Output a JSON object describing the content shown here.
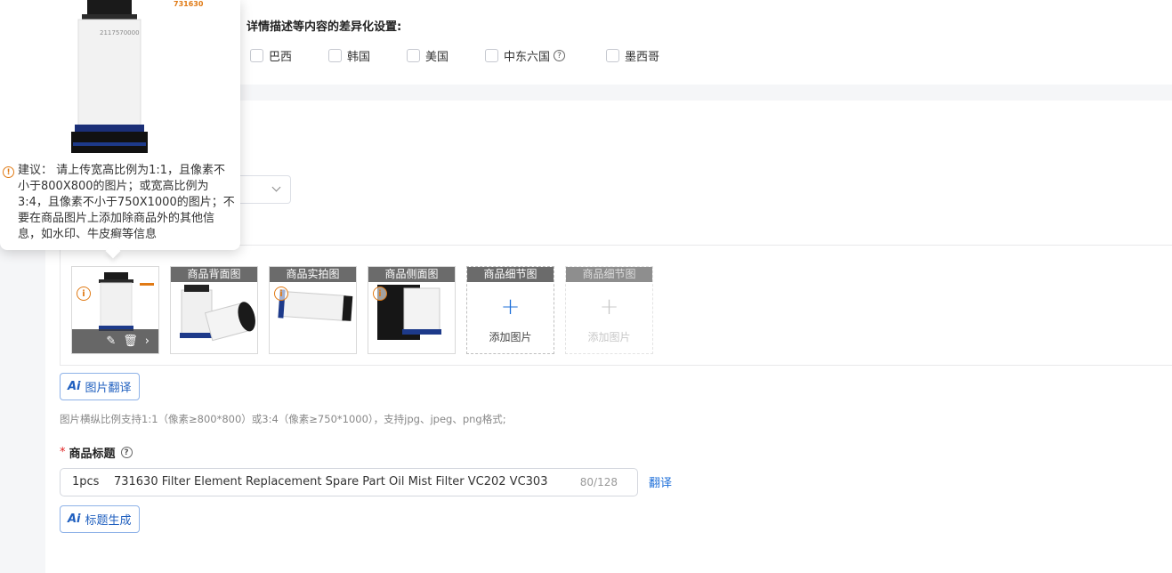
{
  "region_settings": {
    "title": "详情描述等内容的差异化设置:",
    "options": [
      {
        "label": "巴西",
        "checked": false
      },
      {
        "label": "韩国",
        "checked": false
      },
      {
        "label": "美国",
        "checked": false
      },
      {
        "label": "中东六国",
        "checked": false,
        "help": true
      },
      {
        "label": "墨西哥",
        "checked": false
      }
    ]
  },
  "tooltip": {
    "brand_number": "731630",
    "product_code": "2117570000",
    "suggestion": "建议： 请上传宽高比例为1:1，且像素不小于800X800的图片；或宽高比例为3:4，且像素不小于750X1000的图片；不要在商品图片上添加除商品外的其他信息，如水印、牛皮癣等信息"
  },
  "images": {
    "slots": [
      {
        "label": "",
        "filled": true,
        "warning": true,
        "tools": true
      },
      {
        "label": "商品背面图",
        "filled": true,
        "warning": false
      },
      {
        "label": "商品实拍图",
        "filled": true,
        "warning": true
      },
      {
        "label": "商品侧面图",
        "filled": true,
        "warning": true
      },
      {
        "label": "商品细节图",
        "filled": false,
        "add_text": "添加图片",
        "disabled": false
      },
      {
        "label": "商品细节图",
        "filled": false,
        "add_text": "添加图片",
        "disabled": true
      }
    ],
    "translate_button": "图片翻译",
    "hint": "图片横纵比例支持1:1（像素≥800*800）或3:4（像素≥750*1000），支持jpg、jpeg、png格式;"
  },
  "product_title": {
    "label": "商品标题",
    "required_mark": "*",
    "value": "1pcs    731630 Filter Element Replacement Spare Part Oil Mist Filter VC202 VC303",
    "count": "80/128",
    "translate_link": "翻译",
    "generate_button": "标题生成"
  },
  "ai_prefix": "Ai",
  "colors": {
    "accent": "#1e6fd9",
    "warning": "#e07a15",
    "required": "#e02020"
  }
}
